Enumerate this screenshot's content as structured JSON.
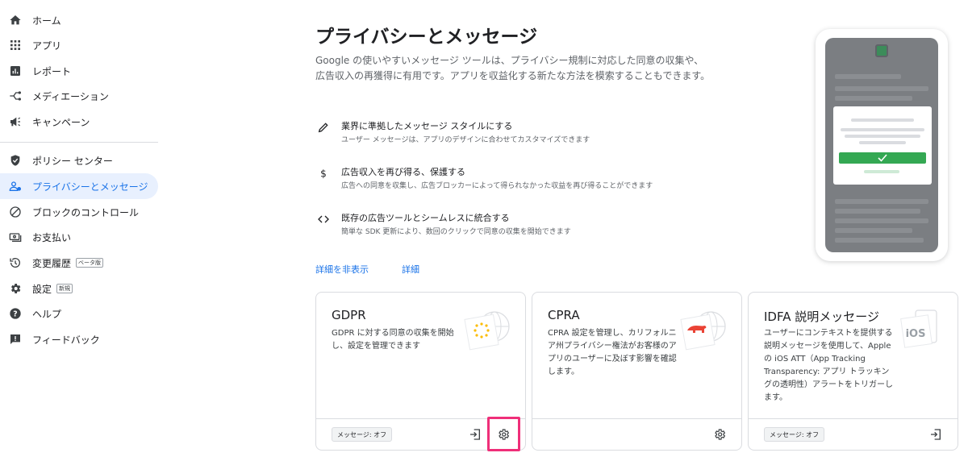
{
  "sidebar": {
    "items": [
      {
        "label": "ホーム",
        "icon": "home-icon"
      },
      {
        "label": "アプリ",
        "icon": "apps-grid-icon"
      },
      {
        "label": "レポート",
        "icon": "bar-chart-icon"
      },
      {
        "label": "メディエーション",
        "icon": "mediation-icon"
      },
      {
        "label": "キャンペーン",
        "icon": "campaign-icon"
      },
      {
        "label": "ポリシー センター",
        "icon": "shield-icon"
      },
      {
        "label": "プライバシーとメッセージ",
        "icon": "privacy-user-icon",
        "active": true
      },
      {
        "label": "ブロックのコントロール",
        "icon": "block-icon"
      },
      {
        "label": "お支払い",
        "icon": "payments-icon"
      },
      {
        "label": "変更履歴",
        "icon": "history-icon",
        "badge": "ベータ版"
      },
      {
        "label": "設定",
        "icon": "gear-icon",
        "badge": "新規"
      },
      {
        "label": "ヘルプ",
        "icon": "help-icon"
      },
      {
        "label": "フィードバック",
        "icon": "feedback-icon"
      }
    ]
  },
  "main": {
    "title": "プライバシーとメッセージ",
    "intro": "Google の使いやすいメッセージ ツールは、プライバシー規制に対応した同意の収集や、広告収入の再獲得に有用です。アプリを収益化する新たな方法を模索することもできます。",
    "features": [
      {
        "icon": "pencil-icon",
        "title": "業界に準拠したメッセージ スタイルにする",
        "desc": "ユーザー メッセージは、アプリのデザインに合わせてカスタマイズできます"
      },
      {
        "icon": "dollar-icon",
        "title": "広告収入を再び得る、保護する",
        "desc": "広告への同意を収集し、広告ブロッカーによって得られなかった収益を再び得ることができます"
      },
      {
        "icon": "code-icon",
        "title": "既存の広告ツールとシームレスに統合する",
        "desc": "簡単な SDK 更新により、数回のクリックで同意の収集を開始できます"
      }
    ],
    "hide_details_link": "詳細を非表示",
    "details_link": "詳細"
  },
  "cards": [
    {
      "title": "GDPR",
      "desc": "GDPR に対する同意の収集を開始し、設定を管理できます",
      "status": "メッセージ: オフ",
      "art": "eu-stars-icon"
    },
    {
      "title": "CPRA",
      "desc": "CPRA 設定を管理し、カリフォルニア州プライバシー権法がお客様のアプリのユーザーに及ぼす影響を確認します。",
      "status": "",
      "art": "california-bear-icon"
    },
    {
      "title": "IDFA 説明メッセージ",
      "desc": "ユーザーにコンテキストを提供する説明メッセージを使用して、Apple の iOS ATT（App Tracking Transparency: アプリ トラッキングの透明性）アラートをトリガーします。",
      "status": "メッセージ: オフ",
      "art": "ios-label-icon",
      "art_text": "iOS"
    }
  ],
  "colors": {
    "accent": "#1a73e8",
    "active_bg": "#e8f0fe",
    "highlight": "#ef2f79",
    "success": "#34a853"
  }
}
